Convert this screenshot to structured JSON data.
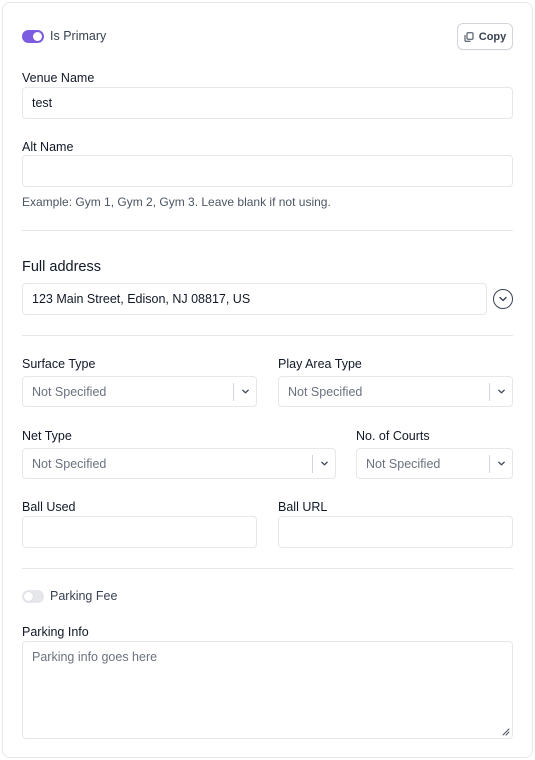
{
  "primary_toggle": {
    "label": "Is Primary",
    "state": "on"
  },
  "copy_button": {
    "label": "Copy",
    "icon": "copy-icon"
  },
  "venue_name": {
    "label": "Venue Name",
    "value": "test"
  },
  "alt_name": {
    "label": "Alt Name",
    "value": "",
    "helper": "Example: Gym 1, Gym 2, Gym 3. Leave blank if not using."
  },
  "address": {
    "title": "Full address",
    "value": "123 Main Street, Edison, NJ 08817, US",
    "expand_icon": "chevron-down-circle-icon"
  },
  "surface_type": {
    "label": "Surface Type",
    "value": "Not Specified"
  },
  "play_area_type": {
    "label": "Play Area Type",
    "value": "Not Specified"
  },
  "net_type": {
    "label": "Net Type",
    "value": "Not Specified"
  },
  "num_courts": {
    "label": "No. of Courts",
    "value": "Not Specified"
  },
  "ball_used": {
    "label": "Ball Used",
    "value": ""
  },
  "ball_url": {
    "label": "Ball URL",
    "value": ""
  },
  "parking_fee_toggle": {
    "label": "Parking Fee",
    "state": "off"
  },
  "parking_info": {
    "label": "Parking Info",
    "placeholder": "Parking info goes here"
  },
  "colors": {
    "accent": "#7c5ce0",
    "border": "#e5e7eb",
    "muted_text": "#6b7280"
  }
}
